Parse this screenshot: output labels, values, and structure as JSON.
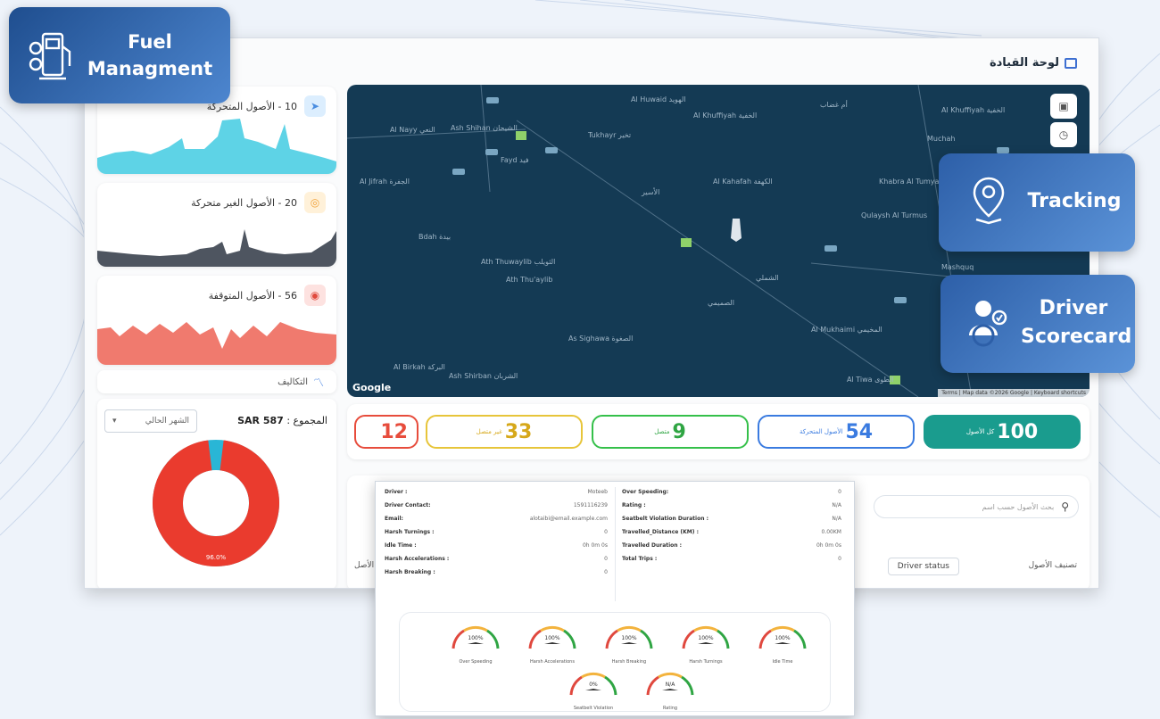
{
  "brand": {
    "line1": "Fuel",
    "line2": "Managment"
  },
  "window": {
    "title": "لوحة القيادة"
  },
  "asset_cards": [
    {
      "label": "10 - الأصول المتحركة",
      "color": "#5ed3e6",
      "icon": "navigation-arrow-icon",
      "badge_bg": "#dceefe",
      "icon_color": "#4a8de0"
    },
    {
      "label": "20 - الأصول الغير متحركة",
      "color": "#4e5560",
      "icon": "target-icon",
      "badge_bg": "#fff1d9",
      "icon_color": "#f1a23a"
    },
    {
      "label": "56 - الأصول المتوقفة",
      "color": "#f07a6e",
      "icon": "stop-circle-icon",
      "badge_bg": "#fde2e0",
      "icon_color": "#e04a3e"
    }
  ],
  "reports": {
    "label": "التكاليف"
  },
  "costs": {
    "total_label": "المجموع :",
    "total_value": "SAR 587",
    "period": "الشهر الحالي",
    "donut_red_pct": 96,
    "donut_label": "96.0%"
  },
  "map": {
    "labels": [
      "Al Huwaid الهويد",
      "Al Khuffiyah الخفية",
      "أم غضاب",
      "Al Khuffiyah الخفية",
      "Al Nayy النعي",
      "Ash Shihan الشيحان",
      "Tukhayr تخير",
      "Fayd فيد",
      "Al Jifrah الجفرة",
      "Al Kahafah الكهفة",
      "الأسير",
      "Muchah",
      "Khabra Al Tumyat",
      "Qulaysh Al Turmus",
      "Bdah بيدة",
      "Ath Thuwaylib الثويلب",
      "Ath Thu'aylib",
      "الشملي",
      "Mashquq",
      "As Sighawa الصغوة",
      "Al Mukhaimi المخيمي",
      "Al Birkah البركة",
      "Ash Shirban الشربان",
      "Al Tiwa الطوى",
      "الصميمي"
    ],
    "google": "Google",
    "attribution": "Terms | Map data ©2026 Google | Keyboard shortcuts"
  },
  "stats": [
    {
      "num": "100",
      "label": "كل الأصول",
      "color": "#1a9c8e",
      "bg": "#1a9c8e",
      "fg": "#ffffff"
    },
    {
      "num": "54",
      "label": "الأصول المتحركة",
      "color": "#3a7be0",
      "bg": "#ffffff",
      "fg": "#3a7be0"
    },
    {
      "num": "9",
      "label": "متصل",
      "color": "#35c04a",
      "bg": "#ffffff",
      "fg": "#2fa543"
    },
    {
      "num": "33",
      "label": "غير متصل",
      "color": "#e7c53a",
      "bg": "#ffffff",
      "fg": "#d6a81a"
    },
    {
      "num": "12",
      "label": "",
      "color": "#e74c3c",
      "bg": "#ffffff",
      "fg": "#e74c3c"
    }
  ],
  "lower": {
    "search_placeholder": "بحث الأصول حسب اسم",
    "cols": {
      "c1": "تصنيف الأصول",
      "driver_status": "Driver status",
      "left": "الأصل"
    }
  },
  "tracking": {
    "label": "Tracking"
  },
  "scorecard": {
    "line1": "Driver",
    "line2": "Scorecard"
  },
  "driver_card": {
    "left": [
      {
        "k": "Driver :",
        "v": "Moteeb"
      },
      {
        "k": "Driver Contact:",
        "v": "1591116239"
      },
      {
        "k": "Email:",
        "v": "alotaibi@email.example.com"
      },
      {
        "k": "Harsh Turnings :",
        "v": "0"
      },
      {
        "k": "Idle Time :",
        "v": "0h 0m 0s"
      },
      {
        "k": "Harsh Accelerations :",
        "v": "0"
      },
      {
        "k": "Harsh Breaking :",
        "v": "0"
      }
    ],
    "right": [
      {
        "k": "Over Speeding:",
        "v": "0"
      },
      {
        "k": "Rating :",
        "v": "N/A"
      },
      {
        "k": "Seatbelt Violation Duration :",
        "v": "N/A"
      },
      {
        "k": "Travelled_Distance (KM) :",
        "v": "0.00KM"
      },
      {
        "k": "Travelled Duration :",
        "v": "0h 0m 0s"
      },
      {
        "k": "Total Trips :",
        "v": "0"
      }
    ],
    "gauges": [
      {
        "value": "100%",
        "label": "Over Speeding"
      },
      {
        "value": "100%",
        "label": "Harsh Accelerations"
      },
      {
        "value": "100%",
        "label": "Harsh Breaking"
      },
      {
        "value": "100%",
        "label": "Harsh Turnings"
      },
      {
        "value": "100%",
        "label": "Idle Time"
      },
      {
        "value": "0%",
        "label": "Seatbelt Violation"
      },
      {
        "value": "N/A",
        "label": "Rating"
      }
    ]
  }
}
